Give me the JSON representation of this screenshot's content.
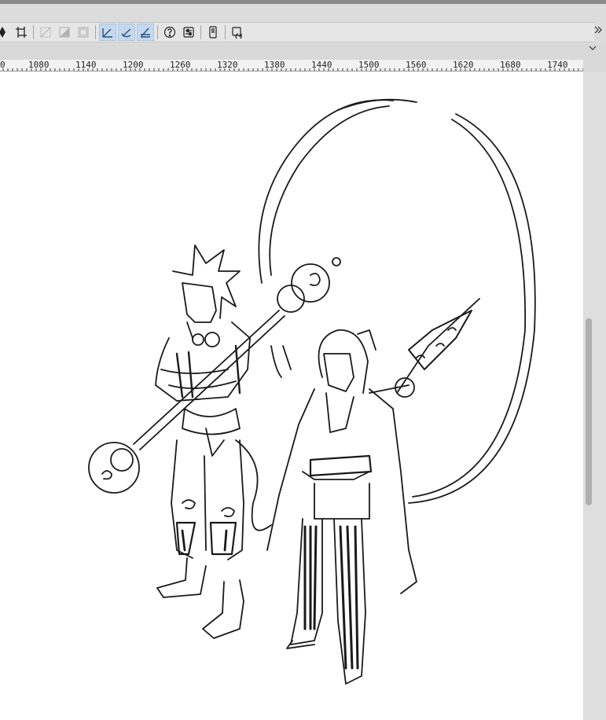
{
  "toolbar": {
    "buttons": [
      {
        "name": "move-layer-tool",
        "icon": "move-arrows-icon",
        "state": "normal"
      },
      {
        "name": "transform-tool",
        "icon": "transform-icon",
        "state": "normal"
      },
      {
        "name": "clear-selection",
        "icon": "clear-selection-icon",
        "state": "disabled"
      },
      {
        "name": "invert-selection",
        "icon": "invert-selection-icon",
        "state": "disabled"
      },
      {
        "name": "selection-border",
        "icon": "selection-border-icon",
        "state": "disabled"
      },
      {
        "name": "snap-to-ruler",
        "icon": "snap-ruler-icon",
        "state": "active"
      },
      {
        "name": "snap-to-special-ruler",
        "icon": "snap-special-ruler-icon",
        "state": "active"
      },
      {
        "name": "snap-to-grid",
        "icon": "snap-grid-icon",
        "state": "active"
      },
      {
        "name": "help",
        "icon": "help-icon",
        "state": "normal"
      },
      {
        "name": "settings",
        "icon": "settings-icon",
        "state": "normal"
      },
      {
        "name": "smartphone",
        "icon": "smartphone-icon",
        "state": "normal"
      },
      {
        "name": "refresh-canvas",
        "icon": "refresh-icon",
        "state": "normal"
      }
    ]
  },
  "ruler": {
    "labels": [
      "0",
      "1080",
      "1140",
      "1200",
      "1260",
      "1320",
      "1380",
      "1440",
      "1500",
      "1560",
      "1620",
      "1680",
      "1740"
    ]
  },
  "colors": {
    "toolbar_bg": "#e6e6e6",
    "active_tool": "#c5d9ee",
    "canvas": "#ffffff",
    "ink": "#1a1a1a"
  }
}
